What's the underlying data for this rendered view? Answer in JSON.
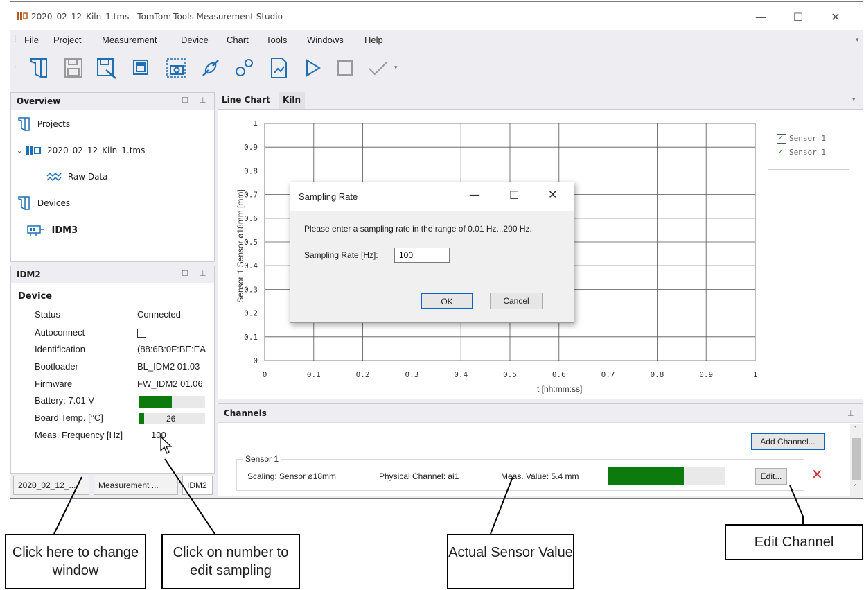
{
  "window": {
    "title": "2020_02_12_Kiln_1.tms - TomTom-Tools Measurement Studio",
    "minimize_glyph": "—",
    "maximize_glyph": "☐",
    "close_glyph": "✕"
  },
  "menu": [
    "File",
    "Project",
    "Measurement",
    "Device",
    "Chart",
    "Tools",
    "Windows",
    "Help"
  ],
  "toolbar_icons": [
    "new-project-icon",
    "save-icon",
    "save-as-icon",
    "copy-window-icon",
    "screenshot-icon",
    "connect-icon",
    "settings-icon",
    "export-chart-icon",
    "start-icon",
    "stop-icon",
    "check-icon"
  ],
  "overview": {
    "title": "Overview",
    "items": {
      "projects": "Projects",
      "file": "2020_02_12_Kiln_1.tms",
      "raw_data": "Raw Data",
      "devices": "Devices",
      "device": "IDM3"
    }
  },
  "idm2": {
    "title": "IDM2",
    "section": "Device",
    "rows": {
      "status_label": "Status",
      "status_value": "Connected",
      "autoconnect_label": "Autoconnect",
      "id_label": "Identification",
      "id_value": "(88:6B:0F:BE:EA",
      "boot_label": "Bootloader",
      "boot_value": "BL_IDM2 01.03",
      "fw_label": "Firmware",
      "fw_value": "FW_IDM2 01.06",
      "battery_label": "Battery: 7.01 V",
      "battery_level": 0.5,
      "temp_label": "Board Temp. [°C]",
      "temp_value": "26",
      "temp_level": 0.08,
      "freq_label": "Meas. Frequency [Hz]",
      "freq_value": "100"
    }
  },
  "bottom_tabs": [
    "2020_02_12_...",
    "Measurement ...",
    "IDM2"
  ],
  "chart_tabs": [
    "Line Chart",
    "Kiln"
  ],
  "chart_data": {
    "type": "line",
    "xlabel": "t [hh:mm:ss]",
    "ylabel": "Sensor 1 Sensor ø18mm [mm]",
    "x_ticks": [
      "0",
      "0.1",
      "0.2",
      "0.3",
      "0.4",
      "0.5",
      "0.6",
      "0.7",
      "0.8",
      "0.9",
      "1"
    ],
    "y_ticks": [
      "0",
      "0.1",
      "0.2",
      "0.3",
      "0.4",
      "0.5",
      "0.6",
      "0.7",
      "0.8",
      "0.9",
      "1"
    ],
    "xlim": [
      0,
      1
    ],
    "ylim": [
      0,
      1
    ],
    "grid": true,
    "legend_position": "top-right",
    "series": [
      {
        "name": "Sensor 1",
        "values": []
      },
      {
        "name": "Sensor 1",
        "values": []
      }
    ]
  },
  "legend": [
    "Sensor 1",
    "Sensor 1"
  ],
  "channels": {
    "title": "Channels",
    "add_button": "Add Channel...",
    "group_label": "Sensor 1",
    "scaling": "Scaling: Sensor ø18mm",
    "physical": "Physical Channel: ai1",
    "meas_value": "Meas. Value: 5.4 mm",
    "meas_level": 0.65,
    "edit_button": "Edit...",
    "delete_glyph": "✕",
    "accent": "#d32f2f",
    "bar_color": "#0c7a0c"
  },
  "dialog": {
    "title": "Sampling Rate",
    "message": "Please enter a sampling rate in the range of 0.01 Hz...200 Hz.",
    "field_label": "Sampling Rate [Hz]:",
    "field_value": "100",
    "ok": "OK",
    "cancel": "Cancel"
  },
  "callouts": {
    "change_window": "Click here to change window",
    "edit_sampling": "Click on number to edit sampling",
    "sensor_value": "Actual Sensor Value",
    "edit_channel": "Edit Channel"
  }
}
